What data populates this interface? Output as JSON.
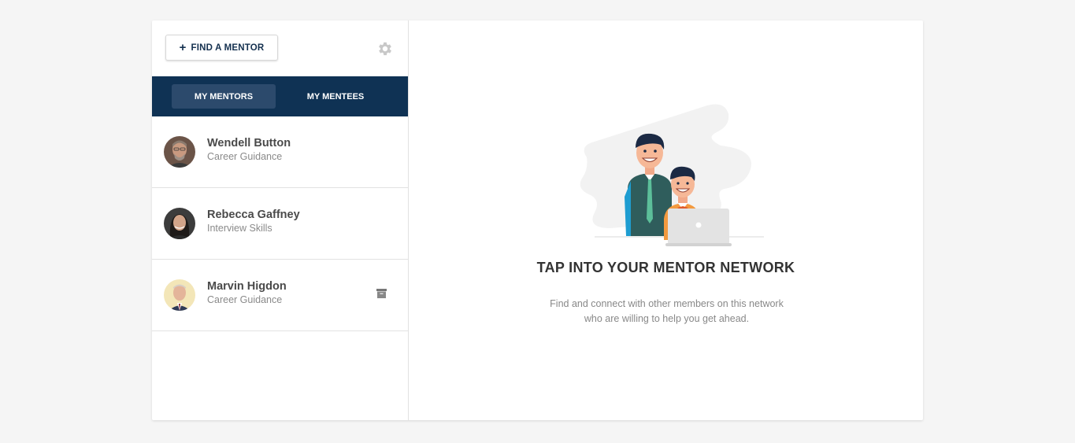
{
  "sidebar": {
    "find_button_label": "FIND A MENTOR",
    "tabs": [
      {
        "label": "MY MENTORS",
        "active": true
      },
      {
        "label": "MY MENTEES",
        "active": false
      }
    ],
    "mentors": [
      {
        "name": "Wendell Button",
        "topic": "Career Guidance",
        "avatar": "avatar-photo"
      },
      {
        "name": "Rebecca Gaffney",
        "topic": "Interview Skills",
        "avatar": "avatar-photo"
      },
      {
        "name": "Marvin Higdon",
        "topic": "Career Guidance",
        "avatar": "avatar-photo",
        "archived_icon": "archive-icon"
      }
    ]
  },
  "main": {
    "headline": "TAP INTO YOUR MENTOR NETWORK",
    "description": "Find and connect with other members on this network who are willing to help you get ahead."
  },
  "colors": {
    "tabbar": "#0f3254",
    "active_tab": "#2c4a6c",
    "button_text": "#14304f",
    "background": "#f5f5f5"
  }
}
